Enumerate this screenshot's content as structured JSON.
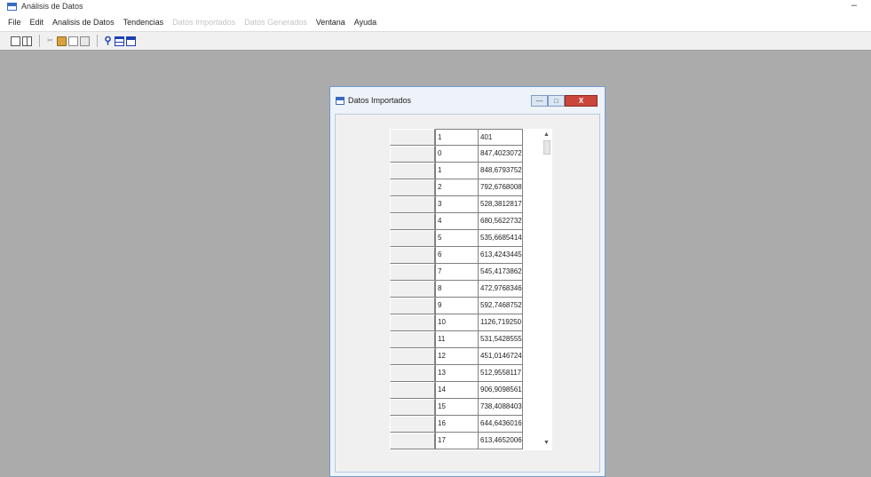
{
  "app": {
    "title": "Análisis de Datos",
    "minimize_glyph": "–"
  },
  "menu": [
    {
      "label": "File",
      "enabled": true
    },
    {
      "label": "Edit",
      "enabled": true
    },
    {
      "label": "Analisis de Datos",
      "enabled": true
    },
    {
      "label": "Tendencias",
      "enabled": true
    },
    {
      "label": "Datos Importados",
      "enabled": false
    },
    {
      "label": "Datos Generados",
      "enabled": false
    },
    {
      "label": "Ventana",
      "enabled": true
    },
    {
      "label": "Ayuda",
      "enabled": true
    }
  ],
  "toolbar": {
    "icons": [
      "new-document-icon",
      "grid-icon",
      "cut-icon",
      "open-folder-icon",
      "copy-icon",
      "paste-icon",
      "tree-icon",
      "table-icon",
      "window-icon"
    ]
  },
  "child_window": {
    "title": "Datos Importados",
    "buttons": {
      "minimize": "—",
      "maximize": "□",
      "close": "X"
    },
    "grid": {
      "header": {
        "index": "1",
        "value": "401"
      },
      "rows": [
        {
          "index": "0",
          "value": "847,4023072"
        },
        {
          "index": "1",
          "value": "848,6793752"
        },
        {
          "index": "2",
          "value": "792,6768008"
        },
        {
          "index": "3",
          "value": "528,3812817"
        },
        {
          "index": "4",
          "value": "680,5622732"
        },
        {
          "index": "5",
          "value": "535,6685414"
        },
        {
          "index": "6",
          "value": "613,4243445"
        },
        {
          "index": "7",
          "value": "545,4173862"
        },
        {
          "index": "8",
          "value": "472,9768346"
        },
        {
          "index": "9",
          "value": "592,7468752"
        },
        {
          "index": "10",
          "value": "1126,719250"
        },
        {
          "index": "11",
          "value": "531,5428555"
        },
        {
          "index": "12",
          "value": "451,0146724"
        },
        {
          "index": "13",
          "value": "512,9558117"
        },
        {
          "index": "14",
          "value": "906,9098561"
        },
        {
          "index": "15",
          "value": "738,4088403"
        },
        {
          "index": "16",
          "value": "644,6436016"
        },
        {
          "index": "17",
          "value": "613,4652006"
        }
      ]
    },
    "scrollbar": {
      "up": "▲",
      "down": "▼"
    }
  },
  "colors": {
    "workspace": "#ababab",
    "window_border": "#6f9bd1",
    "close_button": "#c9463d",
    "toolbar_accent": "#1a3fb4"
  }
}
